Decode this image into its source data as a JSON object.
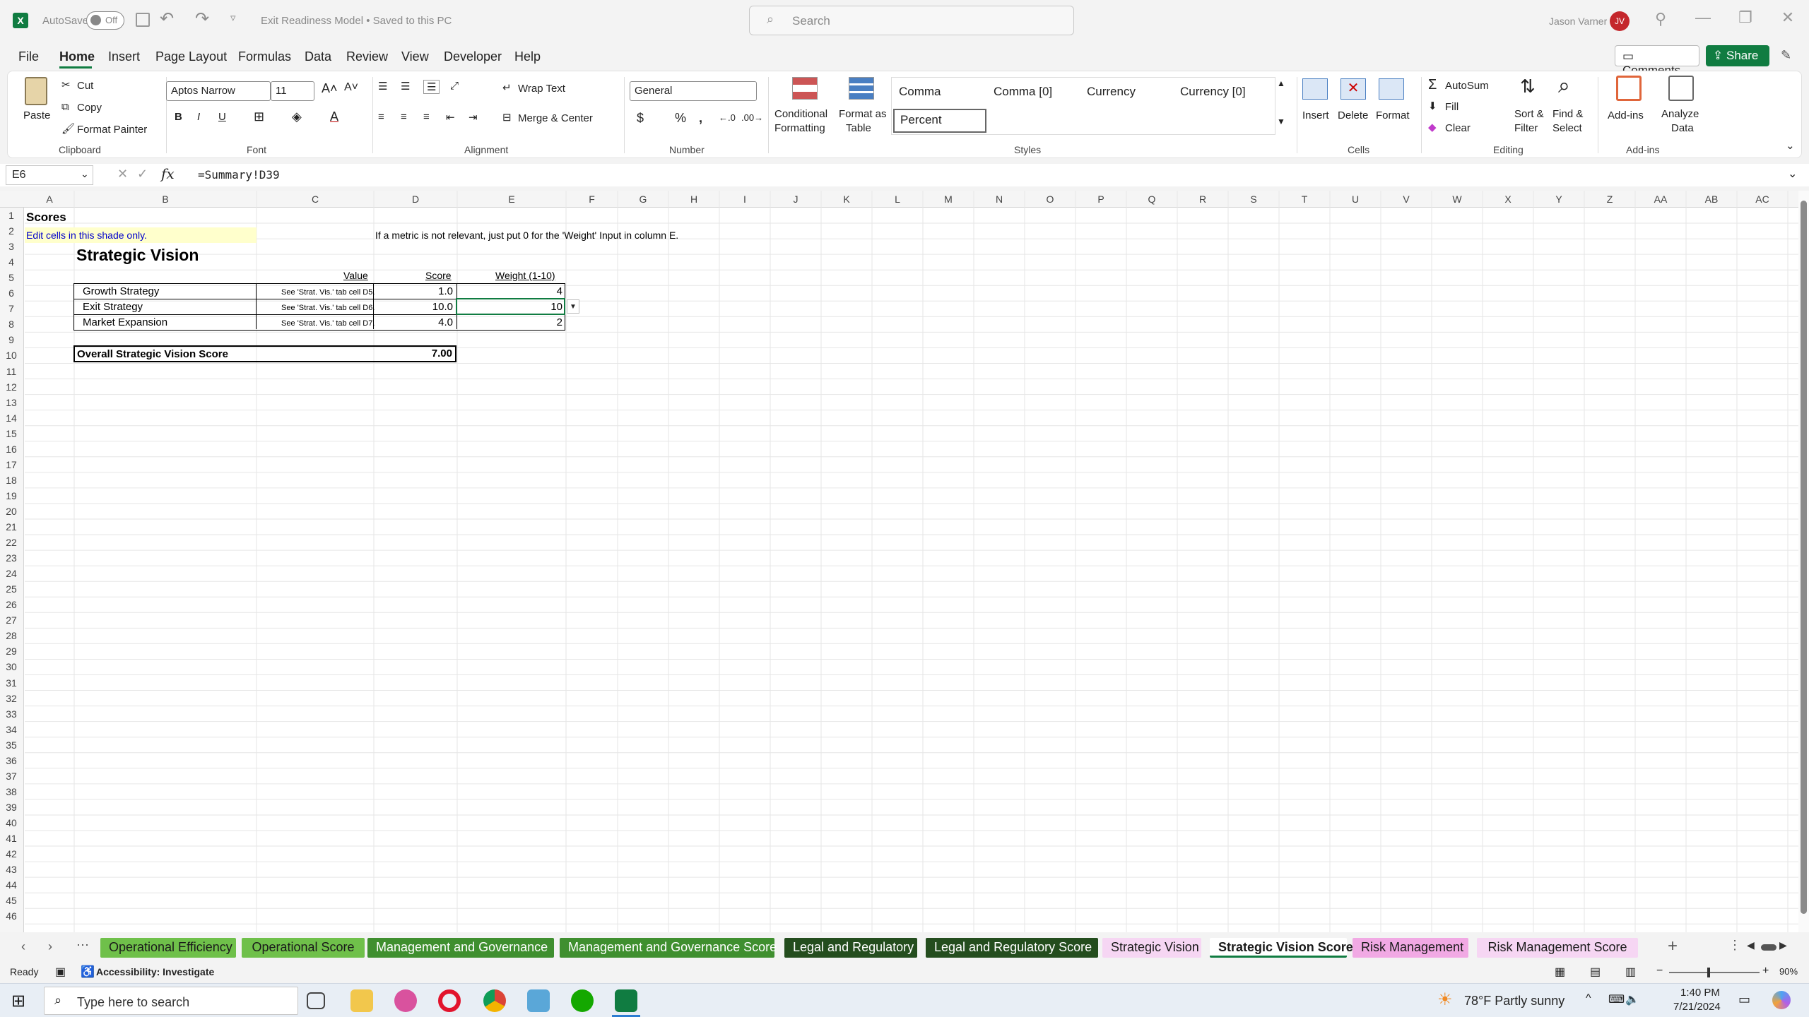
{
  "titlebar": {
    "autosave_label": "AutoSave",
    "autosave_state": "Off",
    "doc_title": "Exit Readiness Model • Saved to this PC",
    "search_placeholder": "Search",
    "user_name": "Jason Varner",
    "user_initials": "JV"
  },
  "menu": {
    "tabs": [
      "File",
      "Home",
      "Insert",
      "Page Layout",
      "Formulas",
      "Data",
      "Review",
      "View",
      "Developer",
      "Help"
    ],
    "active": "Home",
    "comments": "Comments",
    "share": "Share"
  },
  "ribbon": {
    "clipboard": {
      "paste": "Paste",
      "cut": "Cut",
      "copy": "Copy",
      "format_painter": "Format Painter",
      "label": "Clipboard"
    },
    "font": {
      "name": "Aptos Narrow",
      "size": "11",
      "label": "Font"
    },
    "alignment": {
      "wrap": "Wrap Text",
      "merge": "Merge & Center",
      "label": "Alignment"
    },
    "number": {
      "format": "General",
      "label": "Number"
    },
    "styles": {
      "cond1": "Conditional",
      "cond2": "Formatting",
      "fat1": "Format as",
      "fat2": "Table",
      "cells": [
        "Comma",
        "Comma [0]",
        "Currency",
        "Currency [0]",
        "Percent"
      ],
      "label": "Styles"
    },
    "cells": {
      "insert": "Insert",
      "delete": "Delete",
      "format": "Format",
      "label": "Cells"
    },
    "editing": {
      "autosum": "AutoSum",
      "fill": "Fill",
      "clear": "Clear",
      "sort1": "Sort &",
      "sort2": "Filter",
      "find1": "Find &",
      "find2": "Select",
      "label": "Editing"
    },
    "addins": {
      "addins": "Add-ins",
      "analyze1": "Analyze",
      "analyze2": "Data",
      "label": "Add-ins"
    }
  },
  "formula_bar": {
    "name_box": "E6",
    "formula": "=Summary!D39"
  },
  "columns": [
    "A",
    "B",
    "C",
    "D",
    "E",
    "F",
    "G",
    "H",
    "I",
    "J",
    "K",
    "L",
    "M",
    "N",
    "O",
    "P",
    "Q",
    "R",
    "S",
    "T",
    "U",
    "V",
    "W",
    "X",
    "Y",
    "Z",
    "AA",
    "AB",
    "AC"
  ],
  "rows": [
    "1",
    "2",
    "3",
    "4",
    "5",
    "6",
    "7",
    "8",
    "9",
    "10",
    "11",
    "12",
    "13",
    "14",
    "15",
    "16",
    "17",
    "18",
    "19",
    "20",
    "21",
    "22",
    "23",
    "24",
    "25",
    "26",
    "27",
    "28",
    "29",
    "30",
    "31",
    "32",
    "33",
    "34",
    "35",
    "36",
    "37",
    "38",
    "39",
    "40",
    "41",
    "42",
    "43",
    "44",
    "45",
    "46"
  ],
  "sheet": {
    "a1": "Scores",
    "a2": "Edit cells in this shade only.",
    "note": "If a metric is not relevant, just put 0 for the 'Weight' Input in column E.",
    "title": "Strategic Vision",
    "headers": {
      "value": "Value",
      "score": "Score",
      "weight": "Weight (1-10)"
    },
    "metrics": [
      {
        "name": "Growth Strategy",
        "value": "See 'Strat. Vis.' tab cell D5.",
        "score": "1.0",
        "weight": "4"
      },
      {
        "name": "Exit Strategy",
        "value": "See 'Strat. Vis.' tab cell D6.",
        "score": "10.0",
        "weight": "10"
      },
      {
        "name": "Market Expansion",
        "value": "See 'Strat. Vis.' tab cell D7.",
        "score": "4.0",
        "weight": "2"
      }
    ],
    "overall_label": "Overall Strategic Vision Score",
    "overall_value": "7.00"
  },
  "sheet_tabs": [
    {
      "label": "Operational Efficiency",
      "bg": "#6fc04a",
      "fg": "#1a1a1a"
    },
    {
      "label": "Operational Score",
      "bg": "#6fc04a",
      "fg": "#1a1a1a"
    },
    {
      "label": "Management and Governance",
      "bg": "#3f8f2f",
      "fg": "#ffffff"
    },
    {
      "label": "Management and Governance Score",
      "bg": "#3f8f2f",
      "fg": "#ffffff"
    },
    {
      "label": "Legal and Regulatory",
      "bg": "#244d1e",
      "fg": "#ffffff"
    },
    {
      "label": "Legal and Regulatory Score",
      "bg": "#244d1e",
      "fg": "#ffffff"
    },
    {
      "label": "Strategic Vision",
      "bg": "#f6d6f3",
      "fg": "#1a1a1a"
    },
    {
      "label": "Strategic Vision Score",
      "bg": "#ffffff",
      "fg": "#1a1a1a"
    },
    {
      "label": "Risk Management",
      "bg": "#f1a9e4",
      "fg": "#1a1a1a"
    },
    {
      "label": "Risk Management Score",
      "bg": "#f6d6f3",
      "fg": "#1a1a1a"
    }
  ],
  "status": {
    "ready": "Ready",
    "accessibility": "Accessibility: Investigate",
    "zoom": "90%"
  },
  "taskbar": {
    "search": "Type here to search",
    "weather": "78°F  Partly sunny",
    "time": "1:40 PM",
    "date": "7/21/2024"
  }
}
